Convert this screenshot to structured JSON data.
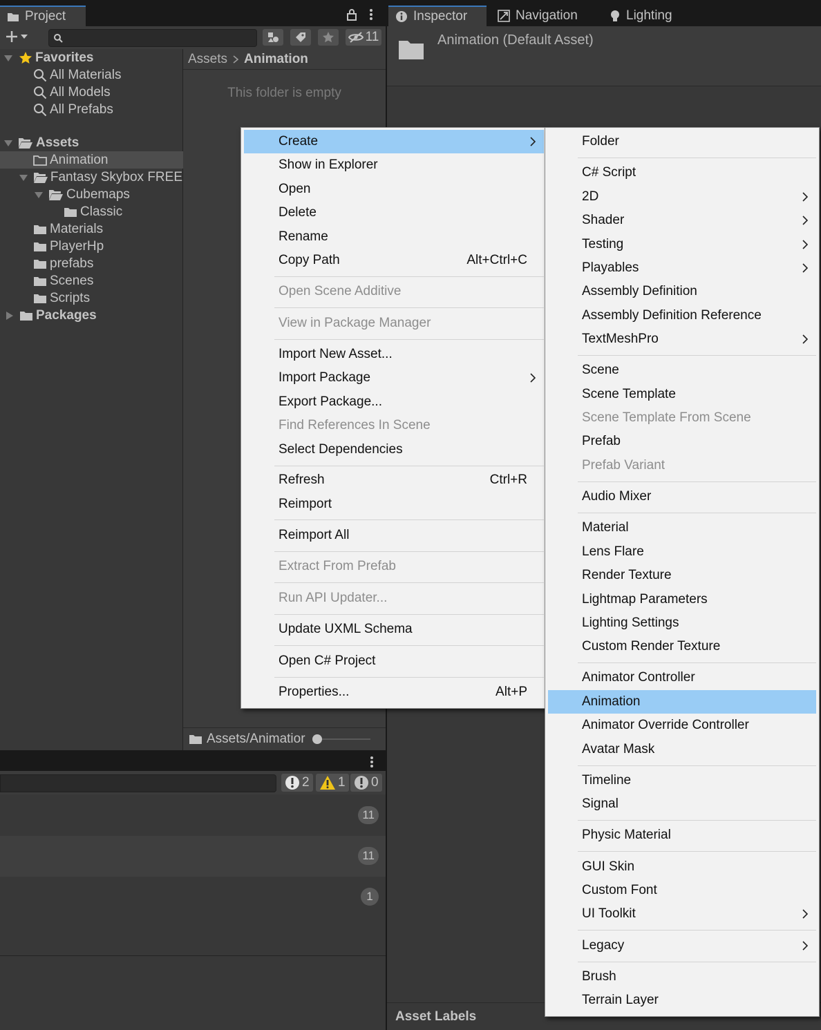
{
  "project": {
    "tab_label": "Project",
    "hidden_count": "11",
    "favorites": {
      "label": "Favorites",
      "items": [
        "All Materials",
        "All Models",
        "All Prefabs"
      ]
    },
    "assets": {
      "label": "Assets",
      "animation": "Animation",
      "fantasy": "Fantasy Skybox FREE",
      "cubemaps": "Cubemaps",
      "classic": "Classic",
      "materials": "Materials",
      "playerhp": "PlayerHp",
      "prefabs": "prefabs",
      "scenes": "Scenes",
      "scripts": "Scripts"
    },
    "packages_label": "Packages",
    "breadcrumb": {
      "root": "Assets",
      "current": "Animation"
    },
    "empty_message": "This folder is empty",
    "status_path": "Assets/Animatior"
  },
  "console": {
    "errors": "2",
    "warnings": "1",
    "messages": "0",
    "row_counts": [
      "11",
      "11",
      "1"
    ]
  },
  "inspector": {
    "tabs": {
      "inspector": "Inspector",
      "navigation": "Navigation",
      "lighting": "Lighting"
    },
    "title": "Animation (Default Asset)",
    "asset_labels": "Asset Labels"
  },
  "context_menu": {
    "create": "Create",
    "show_in_explorer": "Show in Explorer",
    "open": "Open",
    "delete": "Delete",
    "rename": "Rename",
    "copy_path": "Copy Path",
    "copy_path_shortcut": "Alt+Ctrl+C",
    "open_scene_additive": "Open Scene Additive",
    "view_in_package_manager": "View in Package Manager",
    "import_new_asset": "Import New Asset...",
    "import_package": "Import Package",
    "export_package": "Export Package...",
    "find_references": "Find References In Scene",
    "select_dependencies": "Select Dependencies",
    "refresh": "Refresh",
    "refresh_shortcut": "Ctrl+R",
    "reimport": "Reimport",
    "reimport_all": "Reimport All",
    "extract_from_prefab": "Extract From Prefab",
    "run_api_updater": "Run API Updater...",
    "update_uxml": "Update UXML Schema",
    "open_csharp_project": "Open C# Project",
    "properties": "Properties...",
    "properties_shortcut": "Alt+P"
  },
  "create_menu": {
    "folder": "Folder",
    "csharp_script": "C# Script",
    "two_d": "2D",
    "shader": "Shader",
    "testing": "Testing",
    "playables": "Playables",
    "assembly_definition": "Assembly Definition",
    "assembly_definition_reference": "Assembly Definition Reference",
    "textmeshpro": "TextMeshPro",
    "scene": "Scene",
    "scene_template": "Scene Template",
    "scene_template_from_scene": "Scene Template From Scene",
    "prefab": "Prefab",
    "prefab_variant": "Prefab Variant",
    "audio_mixer": "Audio Mixer",
    "material": "Material",
    "lens_flare": "Lens Flare",
    "render_texture": "Render Texture",
    "lightmap_parameters": "Lightmap Parameters",
    "lighting_settings": "Lighting Settings",
    "custom_render_texture": "Custom Render Texture",
    "animator_controller": "Animator Controller",
    "animation": "Animation",
    "animator_override_controller": "Animator Override Controller",
    "avatar_mask": "Avatar Mask",
    "timeline": "Timeline",
    "signal": "Signal",
    "physic_material": "Physic Material",
    "gui_skin": "GUI Skin",
    "custom_font": "Custom Font",
    "ui_toolkit": "UI Toolkit",
    "legacy": "Legacy",
    "brush": "Brush",
    "terrain_layer": "Terrain Layer"
  },
  "colors": {
    "highlight": "#99ccf5",
    "menu_bg": "#f2f2f2",
    "panel_bg": "#383838",
    "favorites_star": "#f5c518",
    "warning": "#f0c419"
  }
}
